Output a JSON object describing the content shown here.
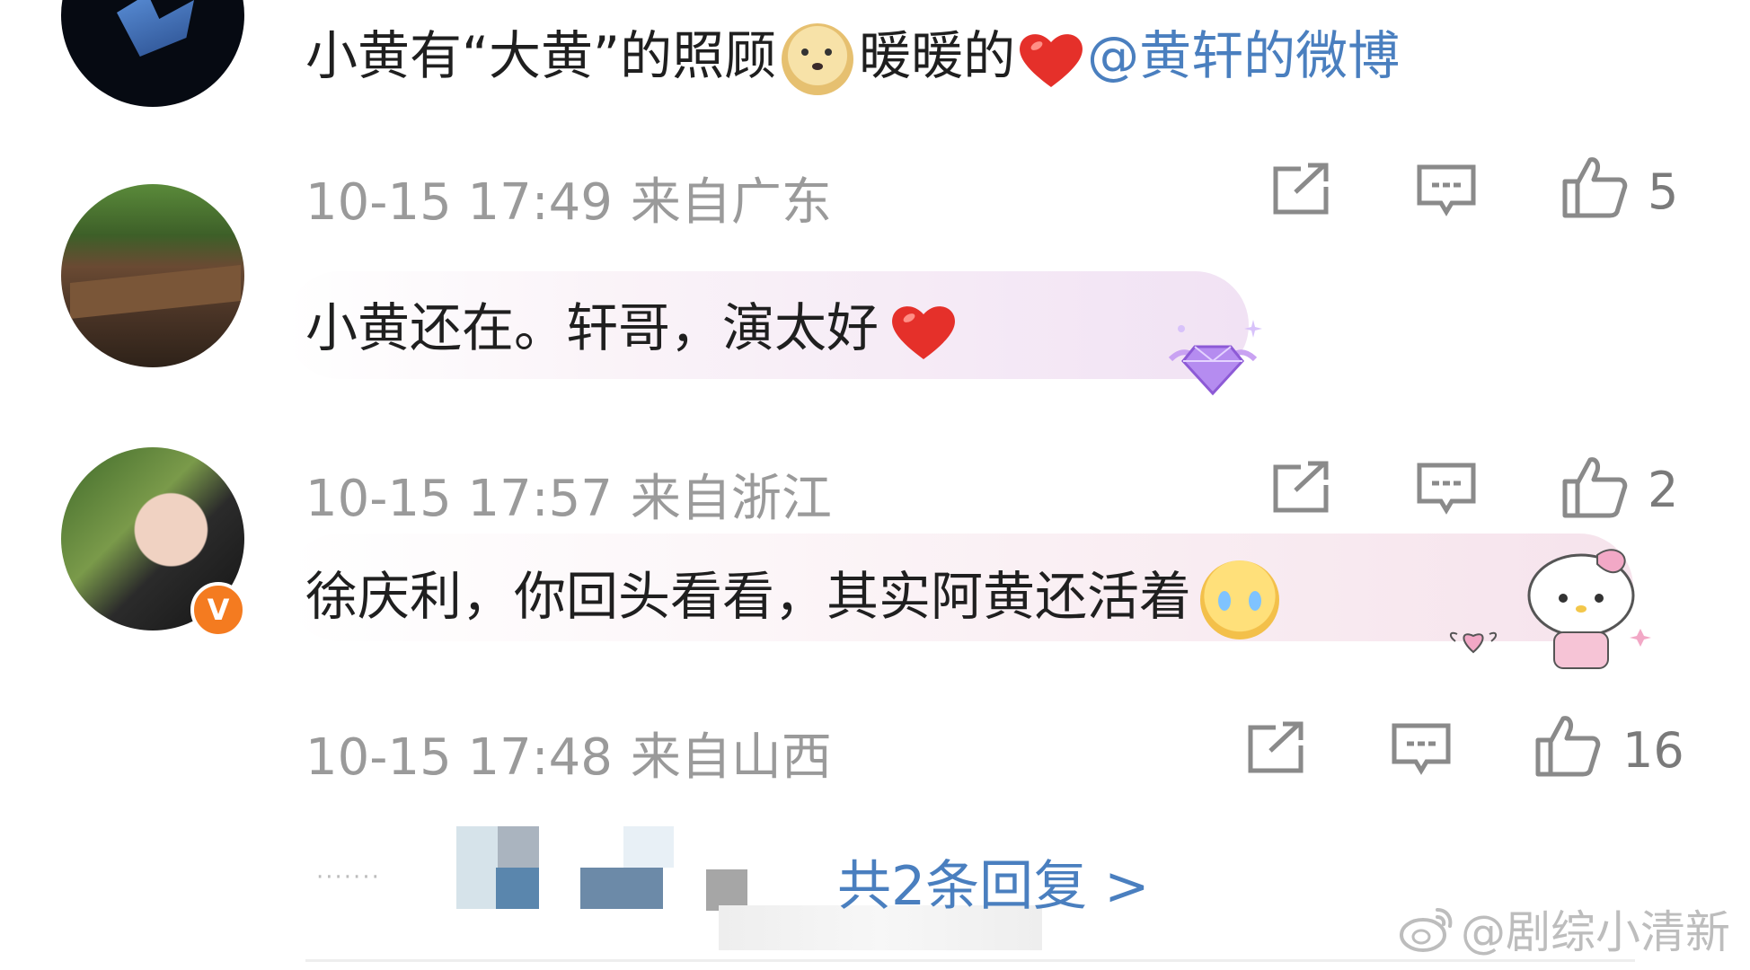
{
  "comments": [
    {
      "text_parts": [
        "小黄有“大黄”的照顾",
        "暖暖的",
        "@黄轩的微博"
      ],
      "emoji": [
        "doge-emoji",
        "heart-emoji"
      ],
      "time": "10-15 17:49",
      "location": "来自广东",
      "likes": "5"
    },
    {
      "text": "小黄还在。轩哥，演太好",
      "emoji": [
        "heart-emoji"
      ],
      "time": "10-15 17:57",
      "location": "来自浙江",
      "likes": "2"
    },
    {
      "text": "徐庆利，你回头看看，其实阿黄还活着",
      "emoji": [
        "crying-emoji"
      ],
      "badge": "V",
      "time": "10-15 17:48",
      "location": "来自山西",
      "likes": "16"
    }
  ],
  "replies_link": "共2条回复 >",
  "dots": "·······",
  "watermark": "@剧综小清新",
  "colors": {
    "mention": "#4a7fbf",
    "meta": "#9a9a9a",
    "badge": "#f47b20",
    "heart": "#e5302a"
  },
  "icons": [
    "share-icon",
    "comment-icon",
    "thumbs-up-icon"
  ]
}
